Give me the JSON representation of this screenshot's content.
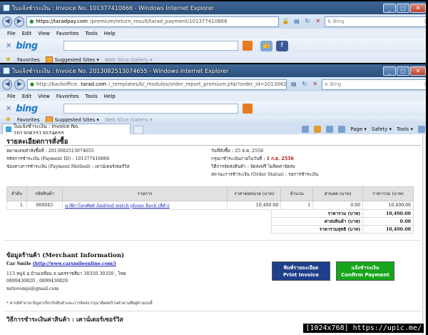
{
  "window1": {
    "title": "ใบแจ้งชำระเงิน : Invoice No. 101377410866 - Windows Internet Explorer",
    "address_host": "https://taradpay.com",
    "address_rest": "/premium/return_result/tarad_payment/101377410866",
    "search_placeholder": "Bing"
  },
  "window2": {
    "title": "ใบแจ้งชำระเงิน : Invoice No. 2013082513074655 - Windows Internet Explorer",
    "address_prefix": "http://backoffice.",
    "address_host": "tarad.com",
    "address_rest": "/_templates/b/_modules/order_report_premium.php?order_id=2013082513074",
    "search_placeholder": "Bing",
    "tab_label": "ใบแจ้งชำระเงิน : Invoice No. 2013082513074655"
  },
  "menu": [
    "File",
    "Edit",
    "View",
    "Favorites",
    "Tools",
    "Help"
  ],
  "bing": {
    "logo": "bing"
  },
  "favbar": {
    "favorites": "Favorites",
    "suggested": "Suggested Sites ▾",
    "webslice": "Web Slice Gallery ▾"
  },
  "cmdbar": {
    "page": "Page ▾",
    "safety": "Safety ▾",
    "tools": "Tools ▾"
  },
  "invoice": {
    "title": "รายละเอียดการสั่งซื้อ",
    "order_no": "หมายเลขคำสั่งซื้อที่ : 2013082513074655",
    "payment_id": "รหัสการชำระเงิน (Payment ID) : 101377410866",
    "payment_method": "ช่องทางการชำระเงิน (Payment Method) : เคาน์เตอร์เซอร์วิส",
    "order_date": "วันที่สั่งซื้อ : 25 ส.ค. 2556",
    "pay_within_label": "กรุณาชำระเงินภายในวันที่ : ",
    "pay_within_value": "1 ก.ย. 2556",
    "shipping": "วิธีการจัดส่งสินค้า : จัดส่งฟรี ไม่คิดค่าจัดส่ง",
    "status": "สถานะการชำระเงิน (Order Status) : รอการชำระเงิน",
    "headers": [
      "ลำดับ",
      "รหัสสินค้า",
      "รายการ",
      "ราคาต่อหน่วย (บาท)",
      "จำนวน",
      "ส่วนลด (บาท)",
      "ราคารวม (บาท)"
    ],
    "rows": [
      [
        "1.",
        "000045",
        "นาฬิกาโทรศัพท์ Andriod watch phone Rock (สีดำ)",
        "10,490.00",
        "1",
        "0.00",
        "10,490.00"
      ]
    ],
    "totals": [
      [
        "ราคารวม (บาท)",
        "10,490.00"
      ],
      [
        "ค่าส่งสินค้า (บาท)",
        "0.00"
      ],
      [
        "ราคารวมสุทธิ (บาท)",
        "10,490.00"
      ]
    ]
  },
  "merchant": {
    "title": "ข้อมูลร้านค้า (Merchant Information)",
    "name": "Car Smile ",
    "url": "(http://www.carsmileonline.com/)",
    "address": "113 หมู่4 อ.บ้านเหลือม จ.นครราชสีมา 30350 30350 , ไทย",
    "phone": "0899430820 , 0899430820",
    "email": "mrlovemju@gmail.com"
  },
  "buttons": {
    "print_th": "พิมพ์รายละเอียด",
    "print_en": "Print Invoice",
    "pay_th": "แจ้งชำระเงิน",
    "pay_en": "Confirm Payment"
  },
  "footnote": "* หากมีคำถาม-ปัญหาเกี่ยวกับสินค้าและการจัดส่ง กรุณาติดต่อร้านค้าตามที่อยู่ด้านบนนี้",
  "payment_method_title": "วิธีการชำระเงินค่าสินค้า : เคาน์เตอร์เซอร์วิส",
  "watermark": "[1024x768] https://upic.me/"
}
